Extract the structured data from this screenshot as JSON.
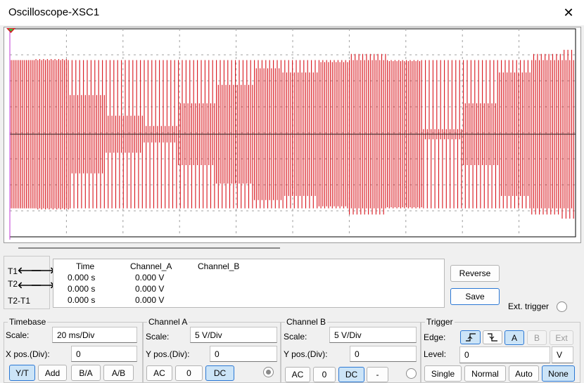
{
  "window": {
    "title": "Oscilloscope-XSC1",
    "close_glyph": "✕"
  },
  "trace_color": "#d8141c",
  "cursors": {
    "t1": "T1",
    "t2": "T2",
    "t2_minus_t1": "T2-T1"
  },
  "readout": {
    "headers": [
      "Time",
      "Channel_A",
      "Channel_B"
    ],
    "rows": [
      [
        "0.000 s",
        "0.000 V",
        ""
      ],
      [
        "0.000 s",
        "0.000 V",
        ""
      ],
      [
        "0.000 s",
        "0.000 V",
        ""
      ]
    ]
  },
  "buttons": {
    "reverse": "Reverse",
    "save": "Save",
    "ext_trigger": "Ext. trigger"
  },
  "timebase": {
    "title": "Timebase",
    "scale_label": "Scale:",
    "scale_value": "20 ms/Div",
    "xpos_label": "X pos.(Div):",
    "xpos_value": "0",
    "modes": [
      "Y/T",
      "Add",
      "B/A",
      "A/B"
    ],
    "active_mode": "Y/T"
  },
  "channel_a": {
    "title": "Channel A",
    "scale_label": "Scale:",
    "scale_value": "5  V/Div",
    "ypos_label": "Y pos.(Div):",
    "ypos_value": "0",
    "coupling": [
      "AC",
      "0",
      "DC"
    ],
    "active_coupling": "DC"
  },
  "channel_b": {
    "title": "Channel B",
    "scale_label": "Scale:",
    "scale_value": "5  V/Div",
    "ypos_label": "Y pos.(Div):",
    "ypos_value": "0",
    "coupling": [
      "AC",
      "0",
      "DC",
      "-"
    ],
    "active_coupling": "DC"
  },
  "trigger": {
    "title": "Trigger",
    "edge_label": "Edge:",
    "sources": [
      "A",
      "B",
      "Ext"
    ],
    "active_source": "A",
    "level_label": "Level:",
    "level_value": "0",
    "level_unit": "V",
    "modes": [
      "Single",
      "Normal",
      "Auto",
      "None"
    ],
    "active_mode": "None"
  }
}
